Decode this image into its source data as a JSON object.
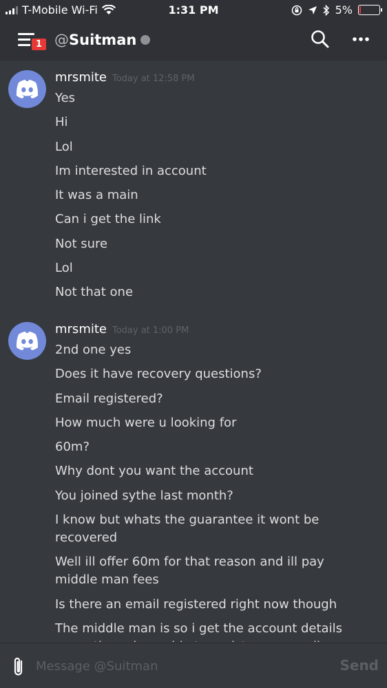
{
  "status_bar": {
    "carrier": "T-Mobile Wi-Fi",
    "time": "1:31 PM",
    "battery_percent": "5%",
    "battery_level": 0.05,
    "battery_color": "#e53935"
  },
  "header": {
    "menu_badge": "1",
    "channel_prefix": "@",
    "channel_name": "Suitman",
    "status_color": "#8e9297"
  },
  "avatar_color": "#7289da",
  "messages": [
    {
      "author": "mrsmite",
      "timestamp": "Today at 12:58 PM",
      "lines": [
        "Yes",
        "Hi",
        "Lol",
        "Im interested in account",
        "It was a main",
        "Can i get the link",
        "Not sure",
        "Lol",
        "Not that one"
      ]
    },
    {
      "author": "mrsmite",
      "timestamp": "Today at 1:00 PM",
      "lines": [
        "2nd one yes",
        "Does it have recovery questions?",
        "Email registered?",
        "How much were u looking for",
        "60m?",
        "Why dont you want the account",
        "You joined sythe last month?",
        "I know but whats the guarantee it wont be recovered",
        "Well ill offer 60m for that reason and ill pay middle man fees",
        "Is there an email registered right now though",
        "The middle man is so i get the account details correctly and am able to register my email"
      ]
    }
  ],
  "composer": {
    "placeholder": "Message @Suitman",
    "send_label": "Send"
  }
}
